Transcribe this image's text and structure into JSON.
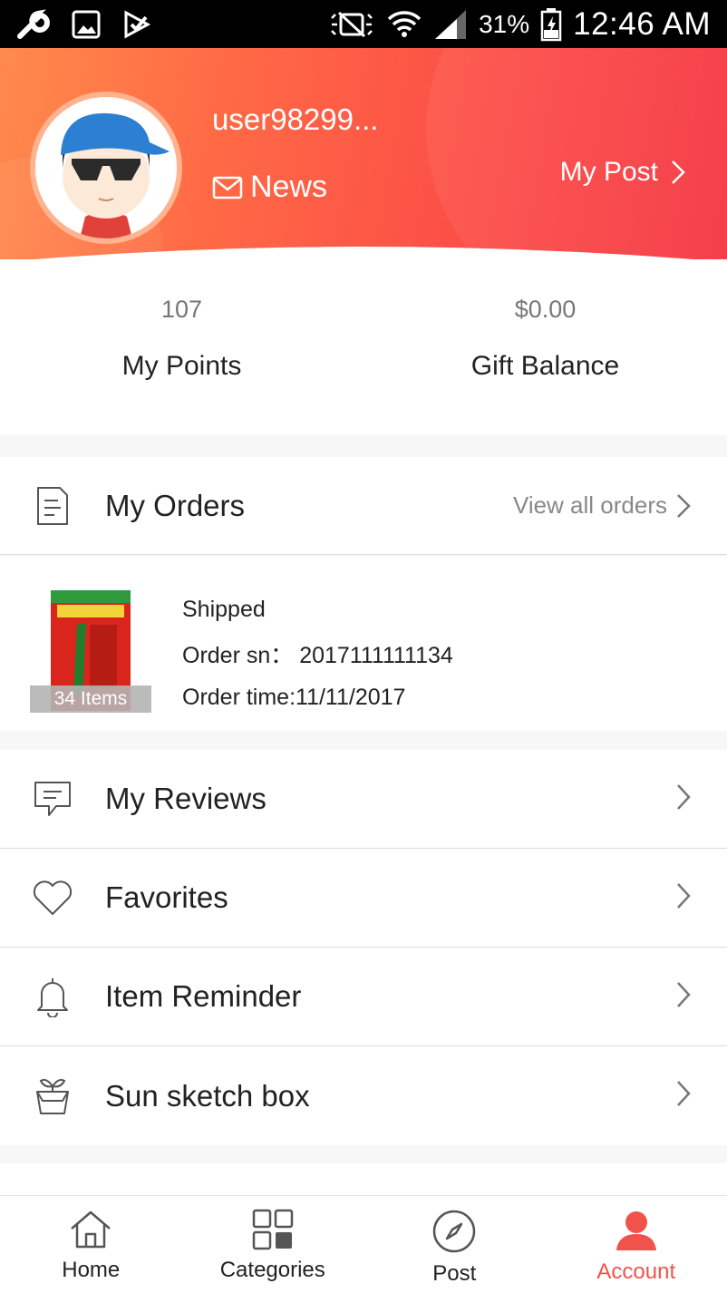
{
  "status_bar": {
    "battery": "31%",
    "time": "12:46 AM",
    "icons": [
      "wrench-icon",
      "image-icon",
      "check-download-icon",
      "mute-icon",
      "wifi-icon",
      "signal-icon",
      "battery-icon"
    ]
  },
  "header": {
    "username": "user98299...",
    "news_label": "News",
    "my_post_label": "My Post",
    "colors": {
      "gradient_start": "#ff8a4c",
      "gradient_end": "#f4343f"
    }
  },
  "stats": {
    "points": {
      "value": "107",
      "label": "My Points"
    },
    "gift": {
      "value": "$0.00",
      "label": "Gift Balance"
    }
  },
  "orders": {
    "title": "My Orders",
    "view_all": "View all orders",
    "latest": {
      "item_count": "34 Items",
      "status": "Shipped",
      "order_sn": "Order sn： 2017111111134",
      "order_time": "Order time:11/11/2017"
    }
  },
  "menu": {
    "items": [
      {
        "label": "My Reviews",
        "icon": "review-icon"
      },
      {
        "label": "Favorites",
        "icon": "heart-icon"
      },
      {
        "label": "Item Reminder",
        "icon": "bell-icon"
      },
      {
        "label": "Sun sketch box",
        "icon": "plant-pot-icon"
      }
    ]
  },
  "bottom_nav": {
    "items": [
      {
        "label": "Home",
        "icon": "home-icon"
      },
      {
        "label": "Categories",
        "icon": "categories-icon"
      },
      {
        "label": "Post",
        "icon": "compass-icon"
      },
      {
        "label": "Account",
        "icon": "account-icon",
        "active": true
      }
    ],
    "active_color": "#f1524c"
  }
}
